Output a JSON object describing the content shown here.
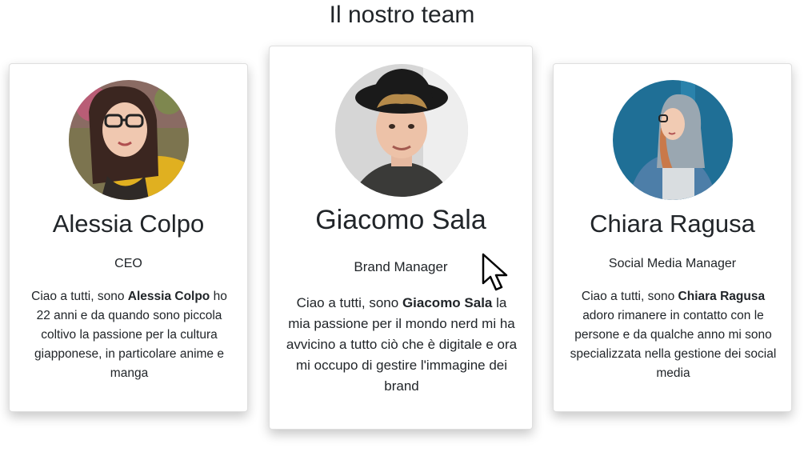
{
  "page": {
    "title": "Il nostro team"
  },
  "members": [
    {
      "name": "Alessia Colpo",
      "role": "CEO",
      "bio_prefix": "Ciao a tutti, sono",
      "bio_name": "Alessia Colpo",
      "bio_suffix": "ho 22 anni e da quando sono piccola coltivo la passione per la cultura giapponese, in particolare anime e manga",
      "photo_alt": "Alessia Colpo"
    },
    {
      "name": "Giacomo Sala",
      "role": "Brand Manager",
      "bio_prefix": "Ciao a tutti, sono",
      "bio_name": "Giacomo Sala",
      "bio_suffix": "la mia passione per il mondo nerd mi ha avvicino a tutto ciò che è digitale e ora mi occupo di gestire l'immagine dei brand",
      "photo_alt": "Giacomo Sala"
    },
    {
      "name": "Chiara Ragusa",
      "role": "Social Media Manager",
      "bio_prefix": "Ciao a tutti, sono",
      "bio_name": "Chiara Ragusa",
      "bio_suffix": "adoro rimanere in contatto con le persone e da qualche anno mi sono specializzata nella gestione dei social media",
      "photo_alt": "Chiara Ragusa"
    }
  ],
  "colors": {
    "text": "#212529",
    "card_border": "rgba(0,0,0,0.125)"
  }
}
